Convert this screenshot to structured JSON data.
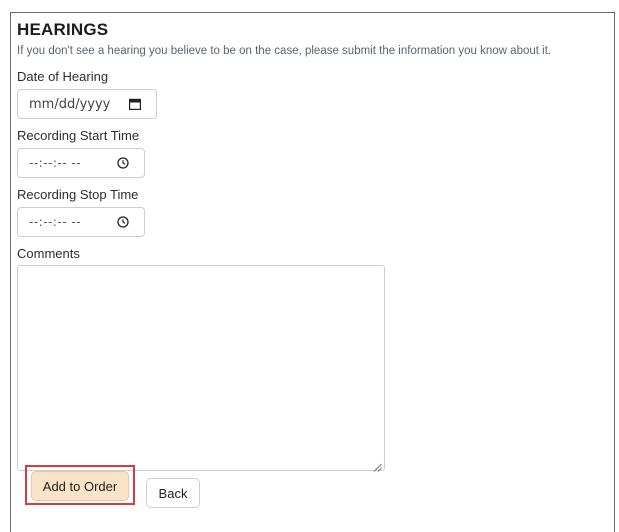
{
  "section": {
    "title": "HEARINGS",
    "subtitle": "If you don't see a hearing you believe to be on the case, please submit the information you know about it."
  },
  "fields": {
    "date": {
      "label": "Date of Hearing",
      "placeholder": "mm/dd/yyyy",
      "icon": "calendar-icon"
    },
    "start_time": {
      "label": "Recording Start Time",
      "placeholder": "--:--:-- --",
      "icon": "clock-icon"
    },
    "stop_time": {
      "label": "Recording Stop Time",
      "placeholder": "--:--:-- --",
      "icon": "clock-icon"
    },
    "comments": {
      "label": "Comments",
      "value": ""
    }
  },
  "actions": {
    "add_label": "Add to Order",
    "back_label": "Back"
  },
  "colors": {
    "add_button_bg": "#fbe3c8",
    "highlight_border": "#d63c3c",
    "subtitle": "#5a6470"
  }
}
